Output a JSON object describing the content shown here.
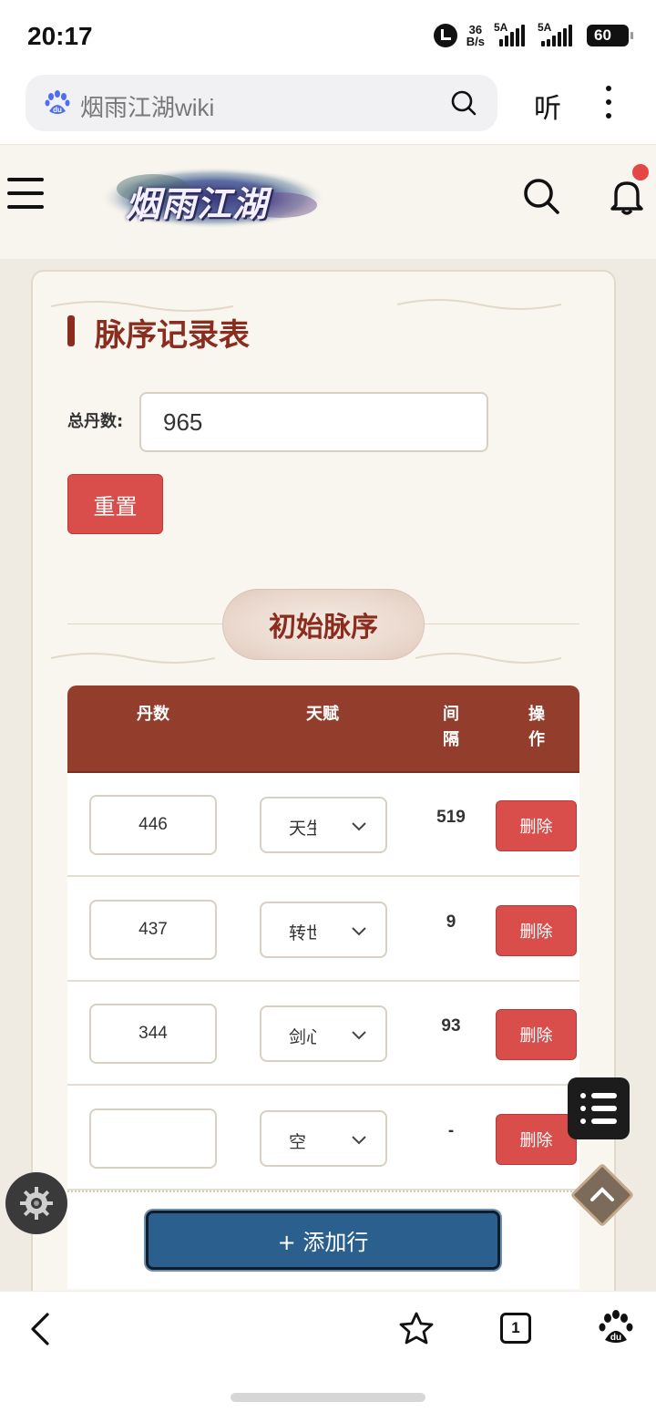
{
  "status_bar": {
    "time": "20:17",
    "net_speed_top": "36",
    "net_speed_bottom": "B/s",
    "signal1_label": "5A",
    "signal2_label": "5A",
    "battery": "60"
  },
  "browser": {
    "url_text": "烟雨江湖wiki",
    "listen_label": "听",
    "icons": [
      "baidu-paw-icon",
      "search-icon",
      "more-vertical-icon"
    ]
  },
  "site_header": {
    "logo_text": "烟雨江湖",
    "icons": [
      "hamburger-menu-icon",
      "search-icon",
      "bell-icon"
    ]
  },
  "form": {
    "title": "脉序记录表",
    "total_label": "总丹数:",
    "total_value": "965",
    "reset_label": "重置"
  },
  "section": {
    "title": "初始脉序"
  },
  "table": {
    "headers": {
      "dan": "丹数",
      "tianfu": "天赋",
      "interval": "间\n隔",
      "action": "操\n作"
    },
    "rows": [
      {
        "dan": "446",
        "tianfu": "天生",
        "interval": "519",
        "action": "删除"
      },
      {
        "dan": "437",
        "tianfu": "转世",
        "interval": "9",
        "action": "删除"
      },
      {
        "dan": "344",
        "tianfu": "剑心",
        "interval": "93",
        "action": "删除"
      },
      {
        "dan": "",
        "tianfu": "空",
        "interval": "-",
        "action": "删除"
      }
    ],
    "add_row_label": "+ 添加行"
  },
  "bottom_nav": {
    "tab_count": "1"
  },
  "colors": {
    "accent_red": "#d94d4a",
    "header_brown": "#933d2d",
    "title_brown": "#8a2d1e",
    "add_blue": "#2b5f8e"
  }
}
